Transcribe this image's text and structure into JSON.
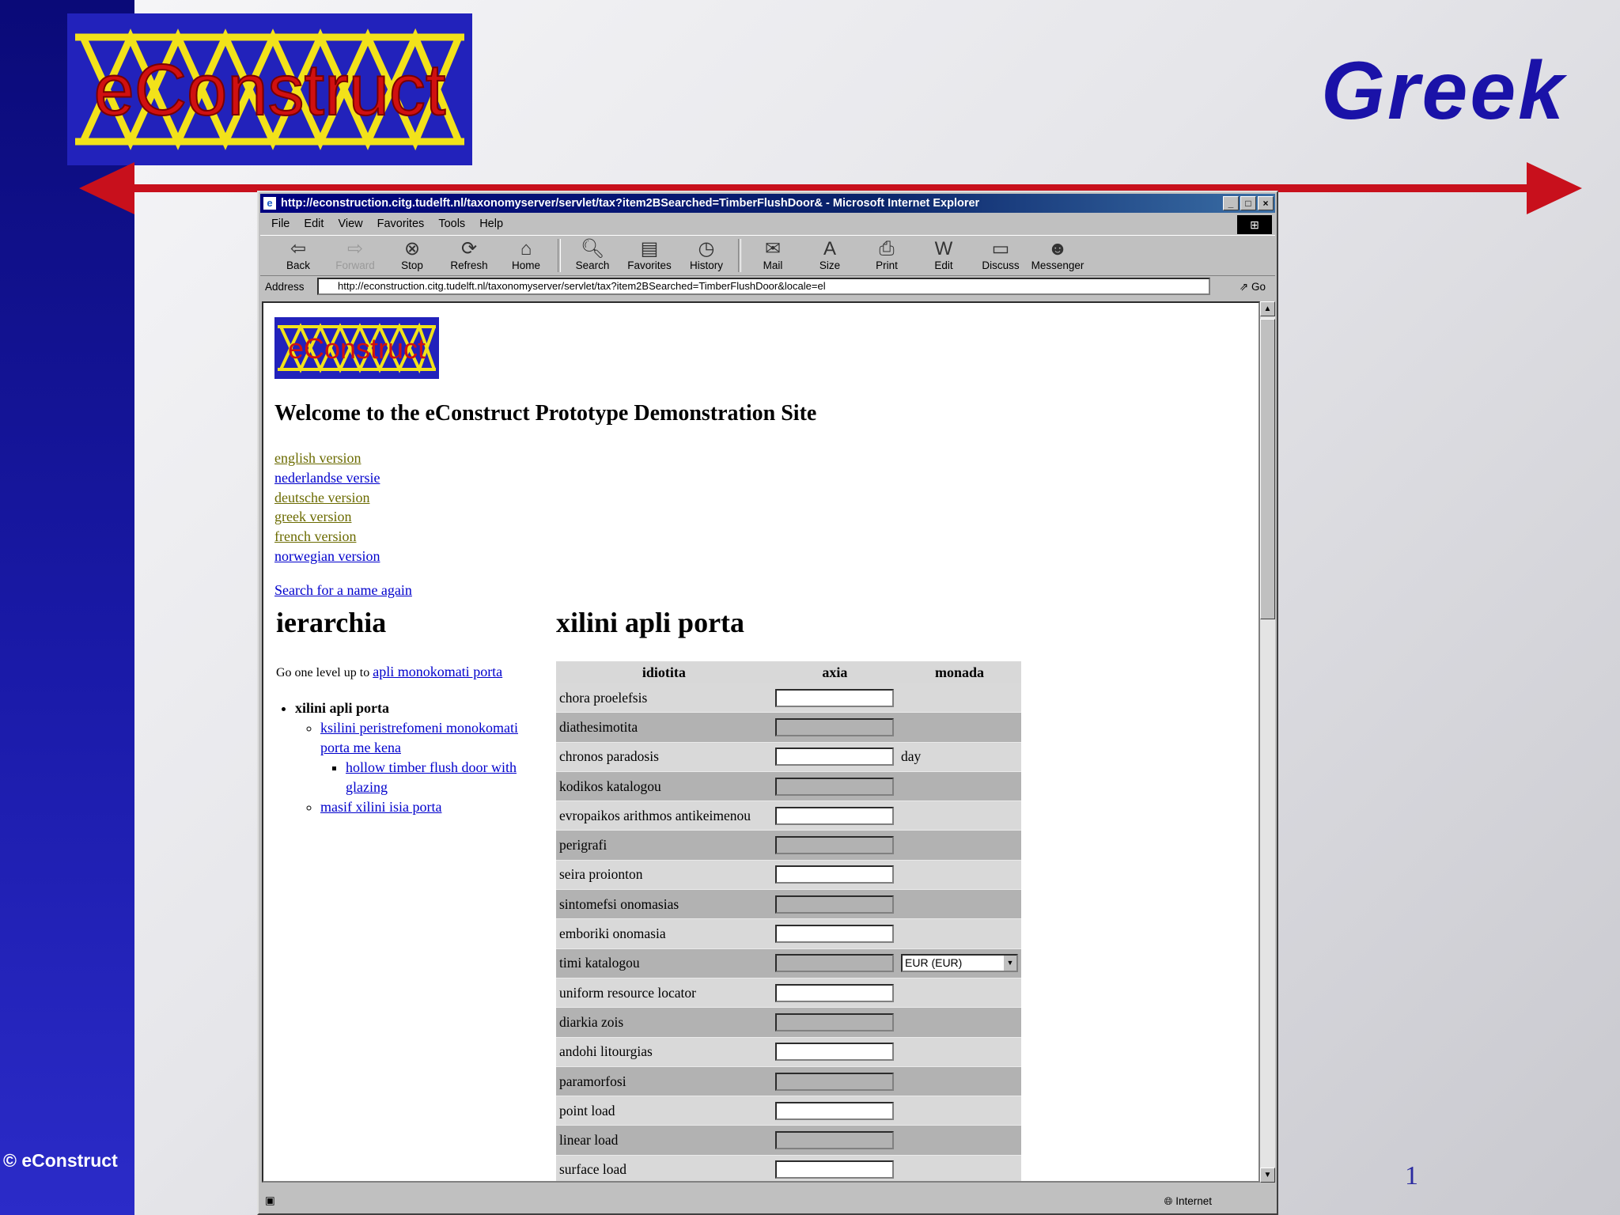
{
  "slide": {
    "title": "Greek",
    "copyright": "© eConstruct",
    "page_number": "1",
    "logo_text": "eConstruct",
    "colors": {
      "sidebar": "#0a0a78",
      "title": "#1a12a8",
      "arrow": "#c8101c",
      "logo_bg": "#2222bb",
      "logo_lattice": "#f2e21a",
      "logo_text": "#d01010"
    }
  },
  "browser": {
    "title": "http://econstruction.citg.tudelft.nl/taxonomyserver/servlet/tax?item2BSearched=TimberFlushDoor& - Microsoft Internet Explorer",
    "window_buttons": [
      "_",
      "□",
      "×"
    ],
    "menu": [
      "File",
      "Edit",
      "View",
      "Favorites",
      "Tools",
      "Help"
    ],
    "toolbar": [
      {
        "label": "Back",
        "icon": "back-arrow"
      },
      {
        "label": "Forward",
        "icon": "forward-arrow"
      },
      {
        "label": "Stop",
        "icon": "stop"
      },
      {
        "label": "Refresh",
        "icon": "refresh"
      },
      {
        "label": "Home",
        "icon": "home"
      },
      {
        "label": "Search",
        "icon": "search"
      },
      {
        "label": "Favorites",
        "icon": "favorites"
      },
      {
        "label": "History",
        "icon": "history"
      },
      {
        "label": "Mail",
        "icon": "mail"
      },
      {
        "label": "Size",
        "icon": "size"
      },
      {
        "label": "Print",
        "icon": "print"
      },
      {
        "label": "Edit",
        "icon": "edit"
      },
      {
        "label": "Discuss",
        "icon": "discuss"
      },
      {
        "label": "Messenger",
        "icon": "messenger"
      }
    ],
    "address_label": "Address",
    "address_url": "http://econstruction.citg.tudelft.nl/taxonomyserver/servlet/tax?item2BSearched=TimberFlushDoor&locale=el",
    "go_label": "Go",
    "status_zone": "Internet"
  },
  "page": {
    "logo_text": "eConstruct",
    "welcome": "Welcome to the eConstruct Prototype Demonstration Site",
    "languages": [
      {
        "label": "english version",
        "visited": true
      },
      {
        "label": "nederlandse versie",
        "visited": false
      },
      {
        "label": "deutsche version",
        "visited": true
      },
      {
        "label": "greek version",
        "visited": true
      },
      {
        "label": "french version",
        "visited": true
      },
      {
        "label": "norwegian version",
        "visited": false
      }
    ],
    "search_again": "Search for a name again",
    "hierarchy_heading": "ierarchia",
    "item_heading": "xilini apli porta",
    "go_up_text": "Go one level up to",
    "go_up_link": "apli monokomati porta",
    "tree": {
      "current": "xilini apli porta",
      "child1": "ksilini peristrefomeni monokomati porta me kena",
      "grandchild1": "hollow timber flush door with glazing",
      "child2": "masif xilini isia porta"
    },
    "table": {
      "headers": [
        "idiotita",
        "axia",
        "monada"
      ],
      "rows": [
        {
          "property": "chora proelefsis",
          "unit": ""
        },
        {
          "property": "diathesimotita",
          "unit": ""
        },
        {
          "property": "chronos paradosis",
          "unit": "day"
        },
        {
          "property": "kodikos katalogou",
          "unit": ""
        },
        {
          "property": "evropaikos arithmos antikeimenou",
          "unit": ""
        },
        {
          "property": "perigrafi",
          "unit": ""
        },
        {
          "property": "seira proionton",
          "unit": ""
        },
        {
          "property": "sintomefsi onomasias",
          "unit": ""
        },
        {
          "property": "emboriki onomasia",
          "unit": ""
        },
        {
          "property": "timi katalogou",
          "unit": "",
          "select": "EUR (EUR)"
        },
        {
          "property": "uniform resource locator",
          "unit": ""
        },
        {
          "property": "diarkia zois",
          "unit": ""
        },
        {
          "property": "andohi litourgias",
          "unit": ""
        },
        {
          "property": "paramorfosi",
          "unit": ""
        },
        {
          "property": "point load",
          "unit": ""
        },
        {
          "property": "linear load",
          "unit": ""
        },
        {
          "property": "surface load",
          "unit": ""
        }
      ]
    }
  }
}
